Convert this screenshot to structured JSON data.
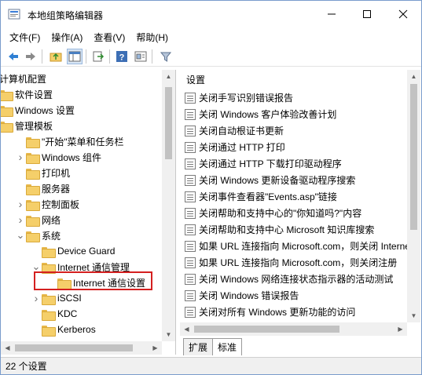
{
  "window": {
    "title": "本地组策略编辑器"
  },
  "menu": [
    "文件(F)",
    "操作(A)",
    "查看(V)",
    "帮助(H)"
  ],
  "toolbar": {
    "icons": [
      "back-arrow-icon",
      "forward-arrow-icon",
      "up-folder-icon",
      "show-hide-tree-icon",
      "export-list-icon",
      "help-icon",
      "properties-icon",
      "filter-icon"
    ]
  },
  "tree": {
    "items": [
      {
        "label": "计算机配置",
        "level": 0,
        "expander": "none",
        "folder": false
      },
      {
        "label": "软件设置",
        "level": 0,
        "expander": "none",
        "folder": true
      },
      {
        "label": "Windows 设置",
        "level": 0,
        "expander": "none",
        "folder": true
      },
      {
        "label": "管理模板",
        "level": 0,
        "expander": "none",
        "folder": true
      },
      {
        "label": "\"开始\"菜单和任务栏",
        "level": 1,
        "expander": "none",
        "folder": true
      },
      {
        "label": "Windows 组件",
        "level": 1,
        "expander": "collapsed",
        "folder": true
      },
      {
        "label": "打印机",
        "level": 1,
        "expander": "none",
        "folder": true
      },
      {
        "label": "服务器",
        "level": 1,
        "expander": "none",
        "folder": true
      },
      {
        "label": "控制面板",
        "level": 1,
        "expander": "collapsed",
        "folder": true
      },
      {
        "label": "网络",
        "level": 1,
        "expander": "collapsed",
        "folder": true
      },
      {
        "label": "系统",
        "level": 1,
        "expander": "expanded",
        "folder": true
      },
      {
        "label": "Device Guard",
        "level": 2,
        "expander": "none",
        "folder": true
      },
      {
        "label": "Internet 通信管理",
        "level": 2,
        "expander": "expanded",
        "folder": true
      },
      {
        "label": "Internet 通信设置",
        "level": 3,
        "expander": "none",
        "folder": true,
        "selected": true
      },
      {
        "label": "iSCSI",
        "level": 2,
        "expander": "collapsed",
        "folder": true
      },
      {
        "label": "KDC",
        "level": 2,
        "expander": "none",
        "folder": true
      },
      {
        "label": "Kerberos",
        "level": 2,
        "expander": "none",
        "folder": true
      }
    ]
  },
  "settings": {
    "column_header": "设置",
    "rows": [
      "关闭手写识别错误报告",
      "关闭 Windows 客户体验改善计划",
      "关闭自动根证书更新",
      "关闭通过 HTTP 打印",
      "关闭通过 HTTP 下载打印驱动程序",
      "关闭 Windows 更新设备驱动程序搜索",
      "关闭事件查看器\"Events.asp\"链接",
      "关闭帮助和支持中心的\"你知道吗?\"内容",
      "关闭帮助和支持中心 Microsoft 知识库搜索",
      "如果 URL 连接指向 Microsoft.com，则关闭 Internet",
      "如果 URL 连接指向 Microsoft.com，则关闭注册",
      "关闭 Windows 网络连接状态指示器的活动测试",
      "关闭 Windows 错误报告",
      "关闭对所有 Windows 更新功能的访问"
    ]
  },
  "tabs": [
    {
      "label": "扩展",
      "active": false
    },
    {
      "label": "标准",
      "active": true
    }
  ],
  "status": {
    "text": "22 个设置"
  },
  "colors": {
    "selection_outline": "#d42020",
    "folder": "#f5cf6a",
    "window_border": "#7a9ccc"
  }
}
